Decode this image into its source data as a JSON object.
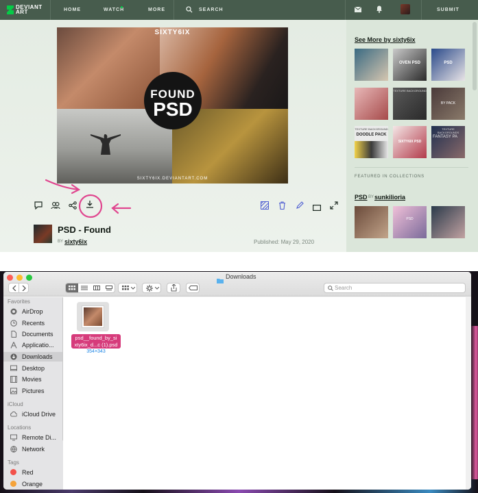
{
  "deviantart": {
    "logo_line1": "DEVIANT",
    "logo_line2": "ART",
    "nav": [
      "HOME",
      "WATCH",
      "MORE"
    ],
    "search_label": "SEARCH",
    "submit_label": "SUBMIT",
    "artwork": {
      "artist_watermark": "SIXTY6IX",
      "big_line1": "FOUND",
      "big_line2": "PSD",
      "url": "SIXTY6IX.DEVIANTART.COM"
    },
    "title": "PSD - Found",
    "by_label": "BY",
    "author": "sixty6ix",
    "published": "Published: May 29, 2020",
    "sidebar": {
      "see_more": "See More by sixty6ix",
      "featured_heading": "FEATURED IN COLLECTIONS",
      "collection_name": "PSD",
      "collection_by": "BY",
      "collection_owner": "sunkilioria",
      "thumb_texts": {
        "t1": "OVEN PSD",
        "t2": "PSD",
        "t3": "TEXTURE BACKGROUND",
        "t4": "BY PACK",
        "t5": "TEXTURE BACKGROUND",
        "t6": "DOODLE PACK",
        "t7": "SIXTY6IX PSD",
        "t8": "TEXTURE BACKGROUNDS",
        "t9": "FANTASY PA",
        "t10": "PSD"
      }
    }
  },
  "finder": {
    "window_title": "Downloads",
    "search_placeholder": "Search",
    "sidebar": {
      "favorites_heading": "Favorites",
      "favorites": [
        "AirDrop",
        "Recents",
        "Documents",
        "Applicatio...",
        "Downloads",
        "Desktop",
        "Movies",
        "Pictures"
      ],
      "icloud_heading": "iCloud",
      "icloud": [
        "iCloud Drive"
      ],
      "locations_heading": "Locations",
      "locations": [
        "Remote Di...",
        "Network"
      ],
      "tags_heading": "Tags",
      "tags": [
        "Red",
        "Orange"
      ]
    },
    "file": {
      "name_line1": "psd__found_by_si",
      "name_line2": "xty6ix_d...c (1).psd",
      "dimensions": "354×343"
    }
  },
  "colors": {
    "da_header": "#475c4d",
    "da_bg": "#dfe8de",
    "annotation_pink": "#e0468f",
    "finder_selection": "#d63b7b",
    "tag_red": "#f2514a",
    "tag_orange": "#f5a33a",
    "finder_accent": "#1a84e5"
  },
  "icons": [
    "deviantart-logo-icon",
    "search-icon",
    "mail-icon",
    "bell-icon",
    "comment-icon",
    "watchers-icon",
    "share-icon",
    "download-icon",
    "stripes-icon",
    "trash-icon",
    "edit-icon",
    "fullscreen-view-icon",
    "expand-icon",
    "airdrop-icon",
    "clock-icon",
    "document-icon",
    "apps-icon",
    "download-folder-icon",
    "desktop-icon",
    "film-icon",
    "pictures-icon",
    "cloud-icon",
    "monitor-icon",
    "globe-icon"
  ]
}
